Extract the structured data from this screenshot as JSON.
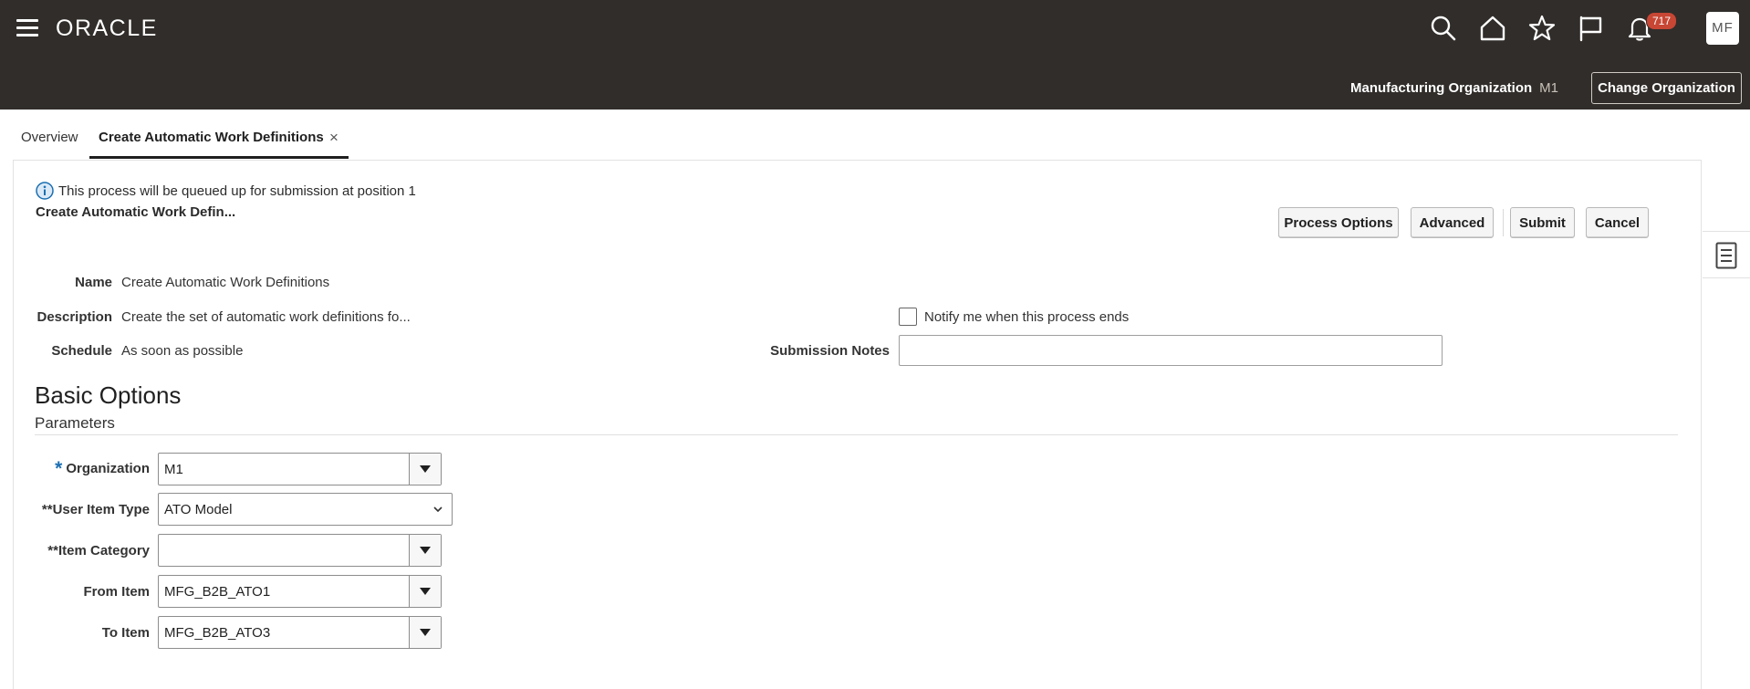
{
  "header": {
    "logo_text": "ORACLE",
    "notifications_count": "717",
    "avatar_initials": "MF",
    "org_label": "Manufacturing Organization",
    "org_code": "M1",
    "change_org_label": "Change Organization"
  },
  "icons": [
    "hamburger-icon",
    "search-icon",
    "home-icon",
    "star-icon",
    "flag-icon",
    "bell-icon",
    "info-icon",
    "task-list-icon",
    "chevron-down-icon"
  ],
  "tabs": [
    {
      "label": "Overview"
    },
    {
      "label": "Create Automatic Work Definitions"
    }
  ],
  "page": {
    "info_message": "This process will be queued up for submission at position 1",
    "process_title": "Create Automatic Work Defin...",
    "buttons": {
      "process_options": "Process Options",
      "advanced": "Advanced",
      "submit": "Submit",
      "cancel": "Cancel"
    },
    "fields": {
      "name_label": "Name",
      "name_value": "Create Automatic Work Definitions",
      "description_label": "Description",
      "description_value": "Create the set of automatic work definitions fo...",
      "schedule_label": "Schedule",
      "schedule_value": "As soon as possible",
      "notify_label": "Notify me when this process ends",
      "notes_label": "Submission Notes",
      "notes_value": ""
    }
  },
  "basic_options": {
    "heading": "Basic Options",
    "subheading": "Parameters",
    "params": {
      "organization_label": "Organization",
      "organization_value": "M1",
      "user_item_type_label": "**User Item Type",
      "user_item_type_value": "ATO Model",
      "item_category_label": "**Item Category",
      "item_category_value": "",
      "from_item_label": "From Item",
      "from_item_value": "MFG_B2B_ATO1",
      "to_item_label": "To Item",
      "to_item_value": "MFG_B2B_ATO3"
    }
  }
}
